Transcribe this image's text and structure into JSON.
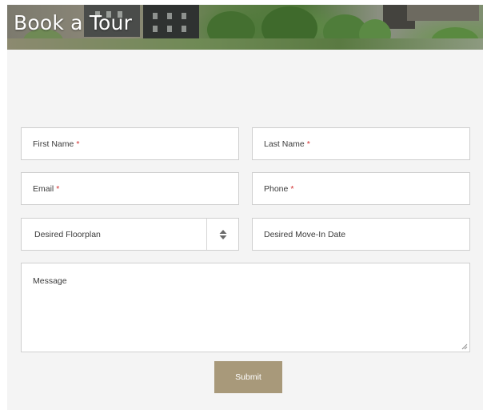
{
  "header": {
    "title": "Book a Tour"
  },
  "form": {
    "first_name": {
      "placeholder": "First Name",
      "required": "*"
    },
    "last_name": {
      "placeholder": "Last Name",
      "required": "*"
    },
    "email": {
      "placeholder": "Email",
      "required": "*"
    },
    "phone": {
      "placeholder": "Phone",
      "required": "*"
    },
    "floorplan": {
      "selected": "Desired Floorplan",
      "icon": "select-arrows-icon"
    },
    "move_in_date": {
      "placeholder": "Desired Move-In Date"
    },
    "message": {
      "placeholder": "Message"
    },
    "submit_label": "Submit"
  },
  "colors": {
    "accent": "#a8997a",
    "required": "#d22d2d",
    "form_background": "#f4f4f4",
    "field_border": "#cfcfcf"
  }
}
